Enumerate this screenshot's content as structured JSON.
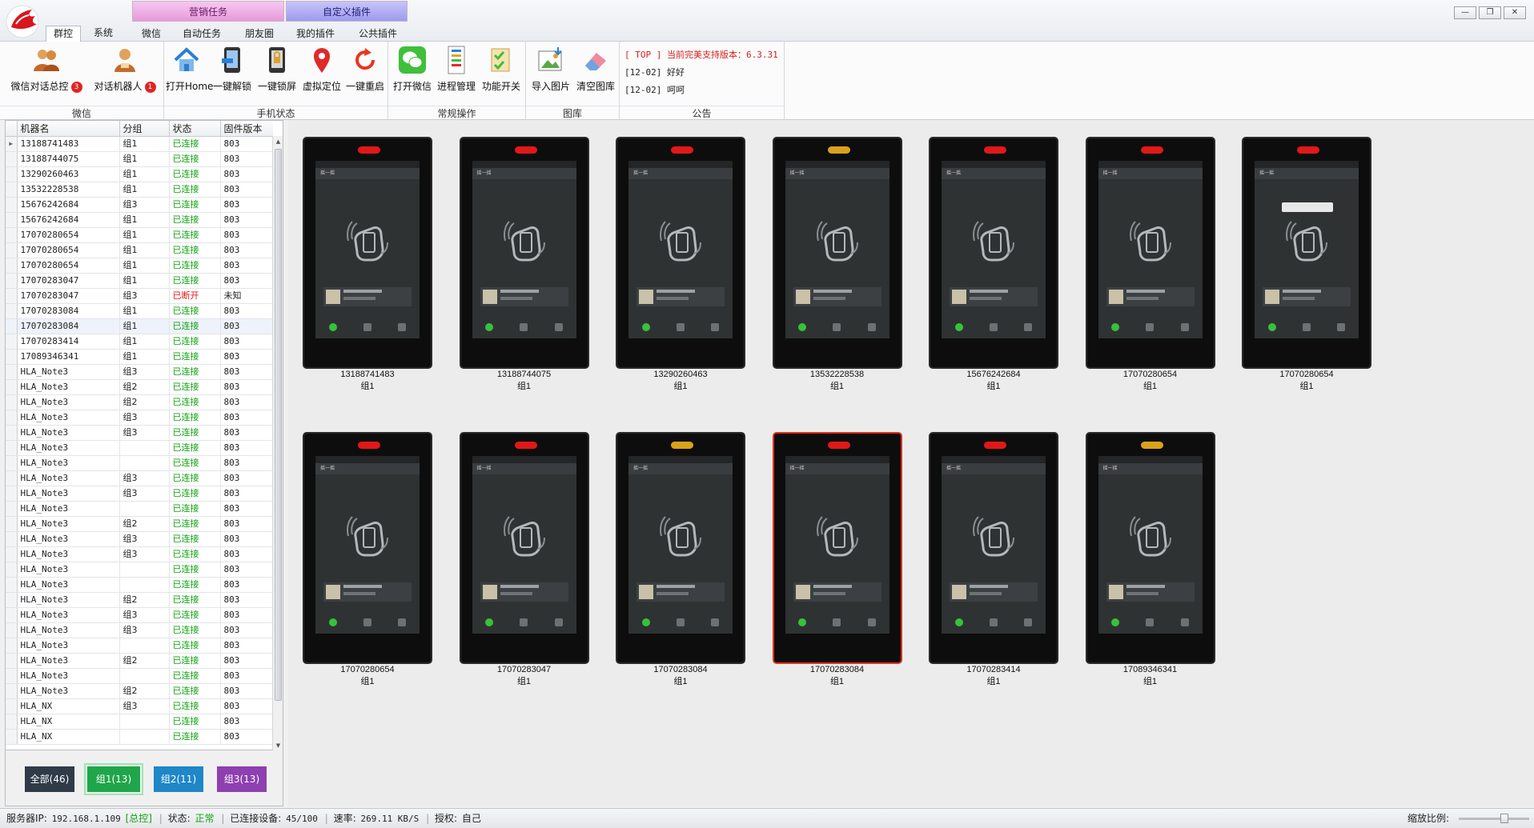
{
  "title_tabs": [
    {
      "label": "群控",
      "active": true
    },
    {
      "label": "系统",
      "active": false
    }
  ],
  "groups": {
    "marketing": {
      "title": "营销任务",
      "tabs": [
        "微信",
        "自动任务",
        "朋友圈"
      ]
    },
    "plugins": {
      "title": "自定义插件",
      "tabs": [
        "我的插件",
        "公共插件"
      ]
    }
  },
  "ribbon": {
    "wechat_group": {
      "label": "微信",
      "buttons": [
        {
          "label": "微信对话总控",
          "badge": "3",
          "icon": "users-icon"
        },
        {
          "label": "对话机器人",
          "badge": "1",
          "icon": "robot-user-icon"
        }
      ]
    },
    "phone_group": {
      "label": "手机状态",
      "buttons": [
        {
          "label": "打开Home",
          "icon": "home-icon"
        },
        {
          "label": "一键解锁",
          "icon": "unlock-phone-icon"
        },
        {
          "label": "一键锁屏",
          "icon": "lock-phone-icon"
        },
        {
          "label": "虚拟定位",
          "icon": "location-pin-icon"
        },
        {
          "label": "一键重启",
          "icon": "restart-icon"
        }
      ]
    },
    "common_group": {
      "label": "常规操作",
      "buttons": [
        {
          "label": "打开微信",
          "icon": "wechat-icon"
        },
        {
          "label": "进程管理",
          "icon": "process-icon"
        },
        {
          "label": "功能开关",
          "icon": "switch-icon"
        }
      ]
    },
    "gallery_group": {
      "label": "图库",
      "buttons": [
        {
          "label": "导入图片",
          "icon": "import-image-icon"
        },
        {
          "label": "清空图库",
          "icon": "eraser-icon"
        }
      ]
    },
    "notice_group": {
      "label": "公告",
      "lines": [
        "[ TOP ] 当前完美支持版本：6.3.31",
        "[12-02] 好好",
        "[12-02] 呵呵"
      ]
    }
  },
  "table": {
    "columns": [
      "机器名",
      "分组",
      "状态",
      "固件版本"
    ],
    "rows": [
      [
        "13188741483",
        "组1",
        "已连接",
        "803"
      ],
      [
        "13188744075",
        "组1",
        "已连接",
        "803"
      ],
      [
        "13290260463",
        "组1",
        "已连接",
        "803"
      ],
      [
        "13532228538",
        "组1",
        "已连接",
        "803"
      ],
      [
        "15676242684",
        "组3",
        "已连接",
        "803"
      ],
      [
        "15676242684",
        "组1",
        "已连接",
        "803"
      ],
      [
        "17070280654",
        "组1",
        "已连接",
        "803"
      ],
      [
        "17070280654",
        "组1",
        "已连接",
        "803"
      ],
      [
        "17070280654",
        "组1",
        "已连接",
        "803"
      ],
      [
        "17070283047",
        "组1",
        "已连接",
        "803"
      ],
      [
        "17070283047",
        "组3",
        "已断开",
        "未知"
      ],
      [
        "17070283084",
        "组1",
        "已连接",
        "803"
      ],
      [
        "17070283084",
        "组1",
        "已连接",
        "803"
      ],
      [
        "17070283414",
        "组1",
        "已连接",
        "803"
      ],
      [
        "17089346341",
        "组1",
        "已连接",
        "803"
      ],
      [
        "HLA_Note3",
        "组3",
        "已连接",
        "803"
      ],
      [
        "HLA_Note3",
        "组2",
        "已连接",
        "803"
      ],
      [
        "HLA_Note3",
        "组2",
        "已连接",
        "803"
      ],
      [
        "HLA_Note3",
        "组3",
        "已连接",
        "803"
      ],
      [
        "HLA_Note3",
        "组3",
        "已连接",
        "803"
      ],
      [
        "HLA_Note3",
        "",
        "已连接",
        "803"
      ],
      [
        "HLA_Note3",
        "",
        "已连接",
        "803"
      ],
      [
        "HLA_Note3",
        "组3",
        "已连接",
        "803"
      ],
      [
        "HLA_Note3",
        "组3",
        "已连接",
        "803"
      ],
      [
        "HLA_Note3",
        "",
        "已连接",
        "803"
      ],
      [
        "HLA_Note3",
        "组2",
        "已连接",
        "803"
      ],
      [
        "HLA_Note3",
        "组3",
        "已连接",
        "803"
      ],
      [
        "HLA_Note3",
        "组3",
        "已连接",
        "803"
      ],
      [
        "HLA_Note3",
        "",
        "已连接",
        "803"
      ],
      [
        "HLA_Note3",
        "",
        "已连接",
        "803"
      ],
      [
        "HLA_Note3",
        "组2",
        "已连接",
        "803"
      ],
      [
        "HLA_Note3",
        "组3",
        "已连接",
        "803"
      ],
      [
        "HLA_Note3",
        "组3",
        "已连接",
        "803"
      ],
      [
        "HLA_Note3",
        "",
        "已连接",
        "803"
      ],
      [
        "HLA_Note3",
        "组2",
        "已连接",
        "803"
      ],
      [
        "HLA_Note3",
        "",
        "已连接",
        "803"
      ],
      [
        "HLA_Note3",
        "组2",
        "已连接",
        "803"
      ],
      [
        "HLA_NX",
        "组3",
        "已连接",
        "803"
      ],
      [
        "HLA_NX",
        "",
        "已连接",
        "803"
      ],
      [
        "HLA_NX",
        "",
        "已连接",
        "803"
      ]
    ]
  },
  "group_buttons": [
    {
      "label": "全部(46)",
      "color": "#2f3b48"
    },
    {
      "label": "组1(13)",
      "color": "#1fa64a"
    },
    {
      "label": "组2(11)",
      "color": "#1f86c7"
    },
    {
      "label": "组3(13)",
      "color": "#8e3fb0"
    }
  ],
  "devices": [
    {
      "number": "13188741483",
      "group": "组1",
      "led": "#e01818"
    },
    {
      "number": "13188744075",
      "group": "组1",
      "led": "#e01818"
    },
    {
      "number": "13290260463",
      "group": "组1",
      "led": "#e01818"
    },
    {
      "number": "13532228538",
      "group": "组1",
      "led": "#d9a21b"
    },
    {
      "number": "15676242684",
      "group": "组1",
      "led": "#e01818"
    },
    {
      "number": "17070280654",
      "group": "组1",
      "led": "#e01818"
    },
    {
      "number": "17070280654",
      "group": "组1",
      "led": "#e01818"
    },
    {
      "number": "17070280654",
      "group": "组1",
      "led": "#e01818"
    },
    {
      "number": "17070283047",
      "group": "组1",
      "led": "#e01818"
    },
    {
      "number": "17070283084",
      "group": "组1",
      "led": "#d9a21b"
    },
    {
      "number": "17070283084",
      "group": "组1",
      "led": "#e01818"
    },
    {
      "number": "17070283414",
      "group": "组1",
      "led": "#e01818"
    },
    {
      "number": "17089346341",
      "group": "组1",
      "led": "#d9a21b"
    }
  ],
  "screen": {
    "app_title": "摇一摇"
  },
  "status": {
    "server_label": "服务器IP:",
    "server_ip": "192.168.1.109",
    "server_role": "[总控]",
    "state_label": "状态:",
    "state_value": "正常",
    "connected_label": "已连接设备:",
    "connected_value": "45/100",
    "speed_label": "速率:",
    "speed_value": "269.11 KB/S",
    "auth_label": "授权:",
    "auth_value": "自己",
    "zoom_label": "缩放比例:"
  }
}
